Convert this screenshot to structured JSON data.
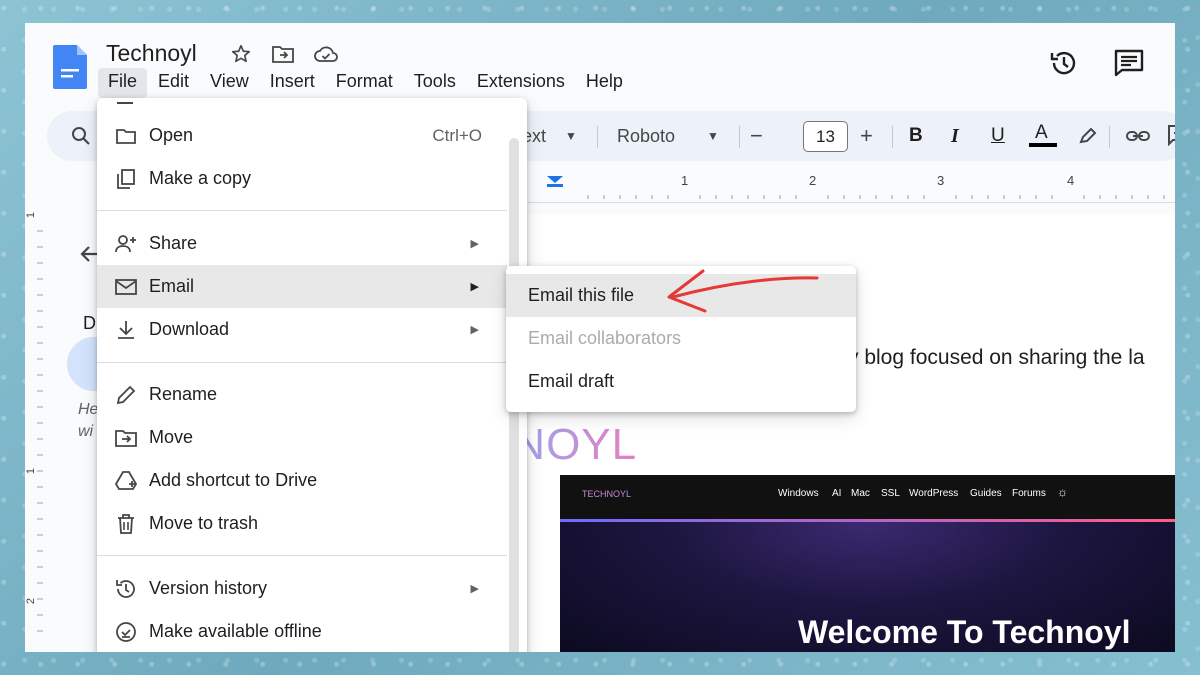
{
  "doc": {
    "title": "Technoyl"
  },
  "menubar": [
    "File",
    "Edit",
    "View",
    "Insert",
    "Format",
    "Tools",
    "Extensions",
    "Help"
  ],
  "toolbar": {
    "style_partial": "ext",
    "font": "Roboto",
    "size": "13",
    "minus": "−",
    "plus": "+",
    "bold": "B",
    "italic": "I",
    "underline": "U",
    "textcolor": "A"
  },
  "ruler": {
    "ticks": [
      "1",
      "2",
      "3",
      "4"
    ]
  },
  "vruler": {
    "ticks": [
      "1",
      "1",
      "2"
    ]
  },
  "sidepanel": {
    "letter": "D",
    "text1": "He",
    "text2": "wi"
  },
  "file_menu": {
    "items": [
      {
        "label": "Open",
        "shortcut": "Ctrl+O",
        "icon": "folder-icon"
      },
      {
        "label": "Make a copy",
        "icon": "copy-icon"
      },
      {
        "label": "Share",
        "icon": "person-add-icon",
        "submenu": true
      },
      {
        "label": "Email",
        "icon": "mail-icon",
        "submenu": true,
        "highlighted": true
      },
      {
        "label": "Download",
        "icon": "download-icon",
        "submenu": true
      },
      {
        "label": "Rename",
        "icon": "pencil-icon"
      },
      {
        "label": "Move",
        "icon": "move-folder-icon"
      },
      {
        "label": "Add shortcut to Drive",
        "icon": "drive-shortcut-icon"
      },
      {
        "label": "Move to trash",
        "icon": "trash-icon"
      },
      {
        "label": "Version history",
        "icon": "history-icon",
        "submenu": true
      },
      {
        "label": "Make available offline",
        "icon": "offline-icon"
      }
    ]
  },
  "email_submenu": {
    "items": [
      {
        "label": "Email this file",
        "highlighted": true
      },
      {
        "label": "Email collaborators",
        "disabled": true
      },
      {
        "label": "Email draft"
      }
    ]
  },
  "body_text": "y blog focused on sharing the la",
  "watermark": "TECHNOYL",
  "site": {
    "logo": "TECHNOYL",
    "nav": [
      "Windows",
      "AI",
      "Mac",
      "SSL",
      "WordPress",
      "Guides",
      "Forums"
    ],
    "hero_title": "Welcome To Technoyl"
  },
  "colors": {
    "accent": "#1a73e8",
    "arrow": "#e53935",
    "menu_highlight": "#e8e8e8"
  }
}
